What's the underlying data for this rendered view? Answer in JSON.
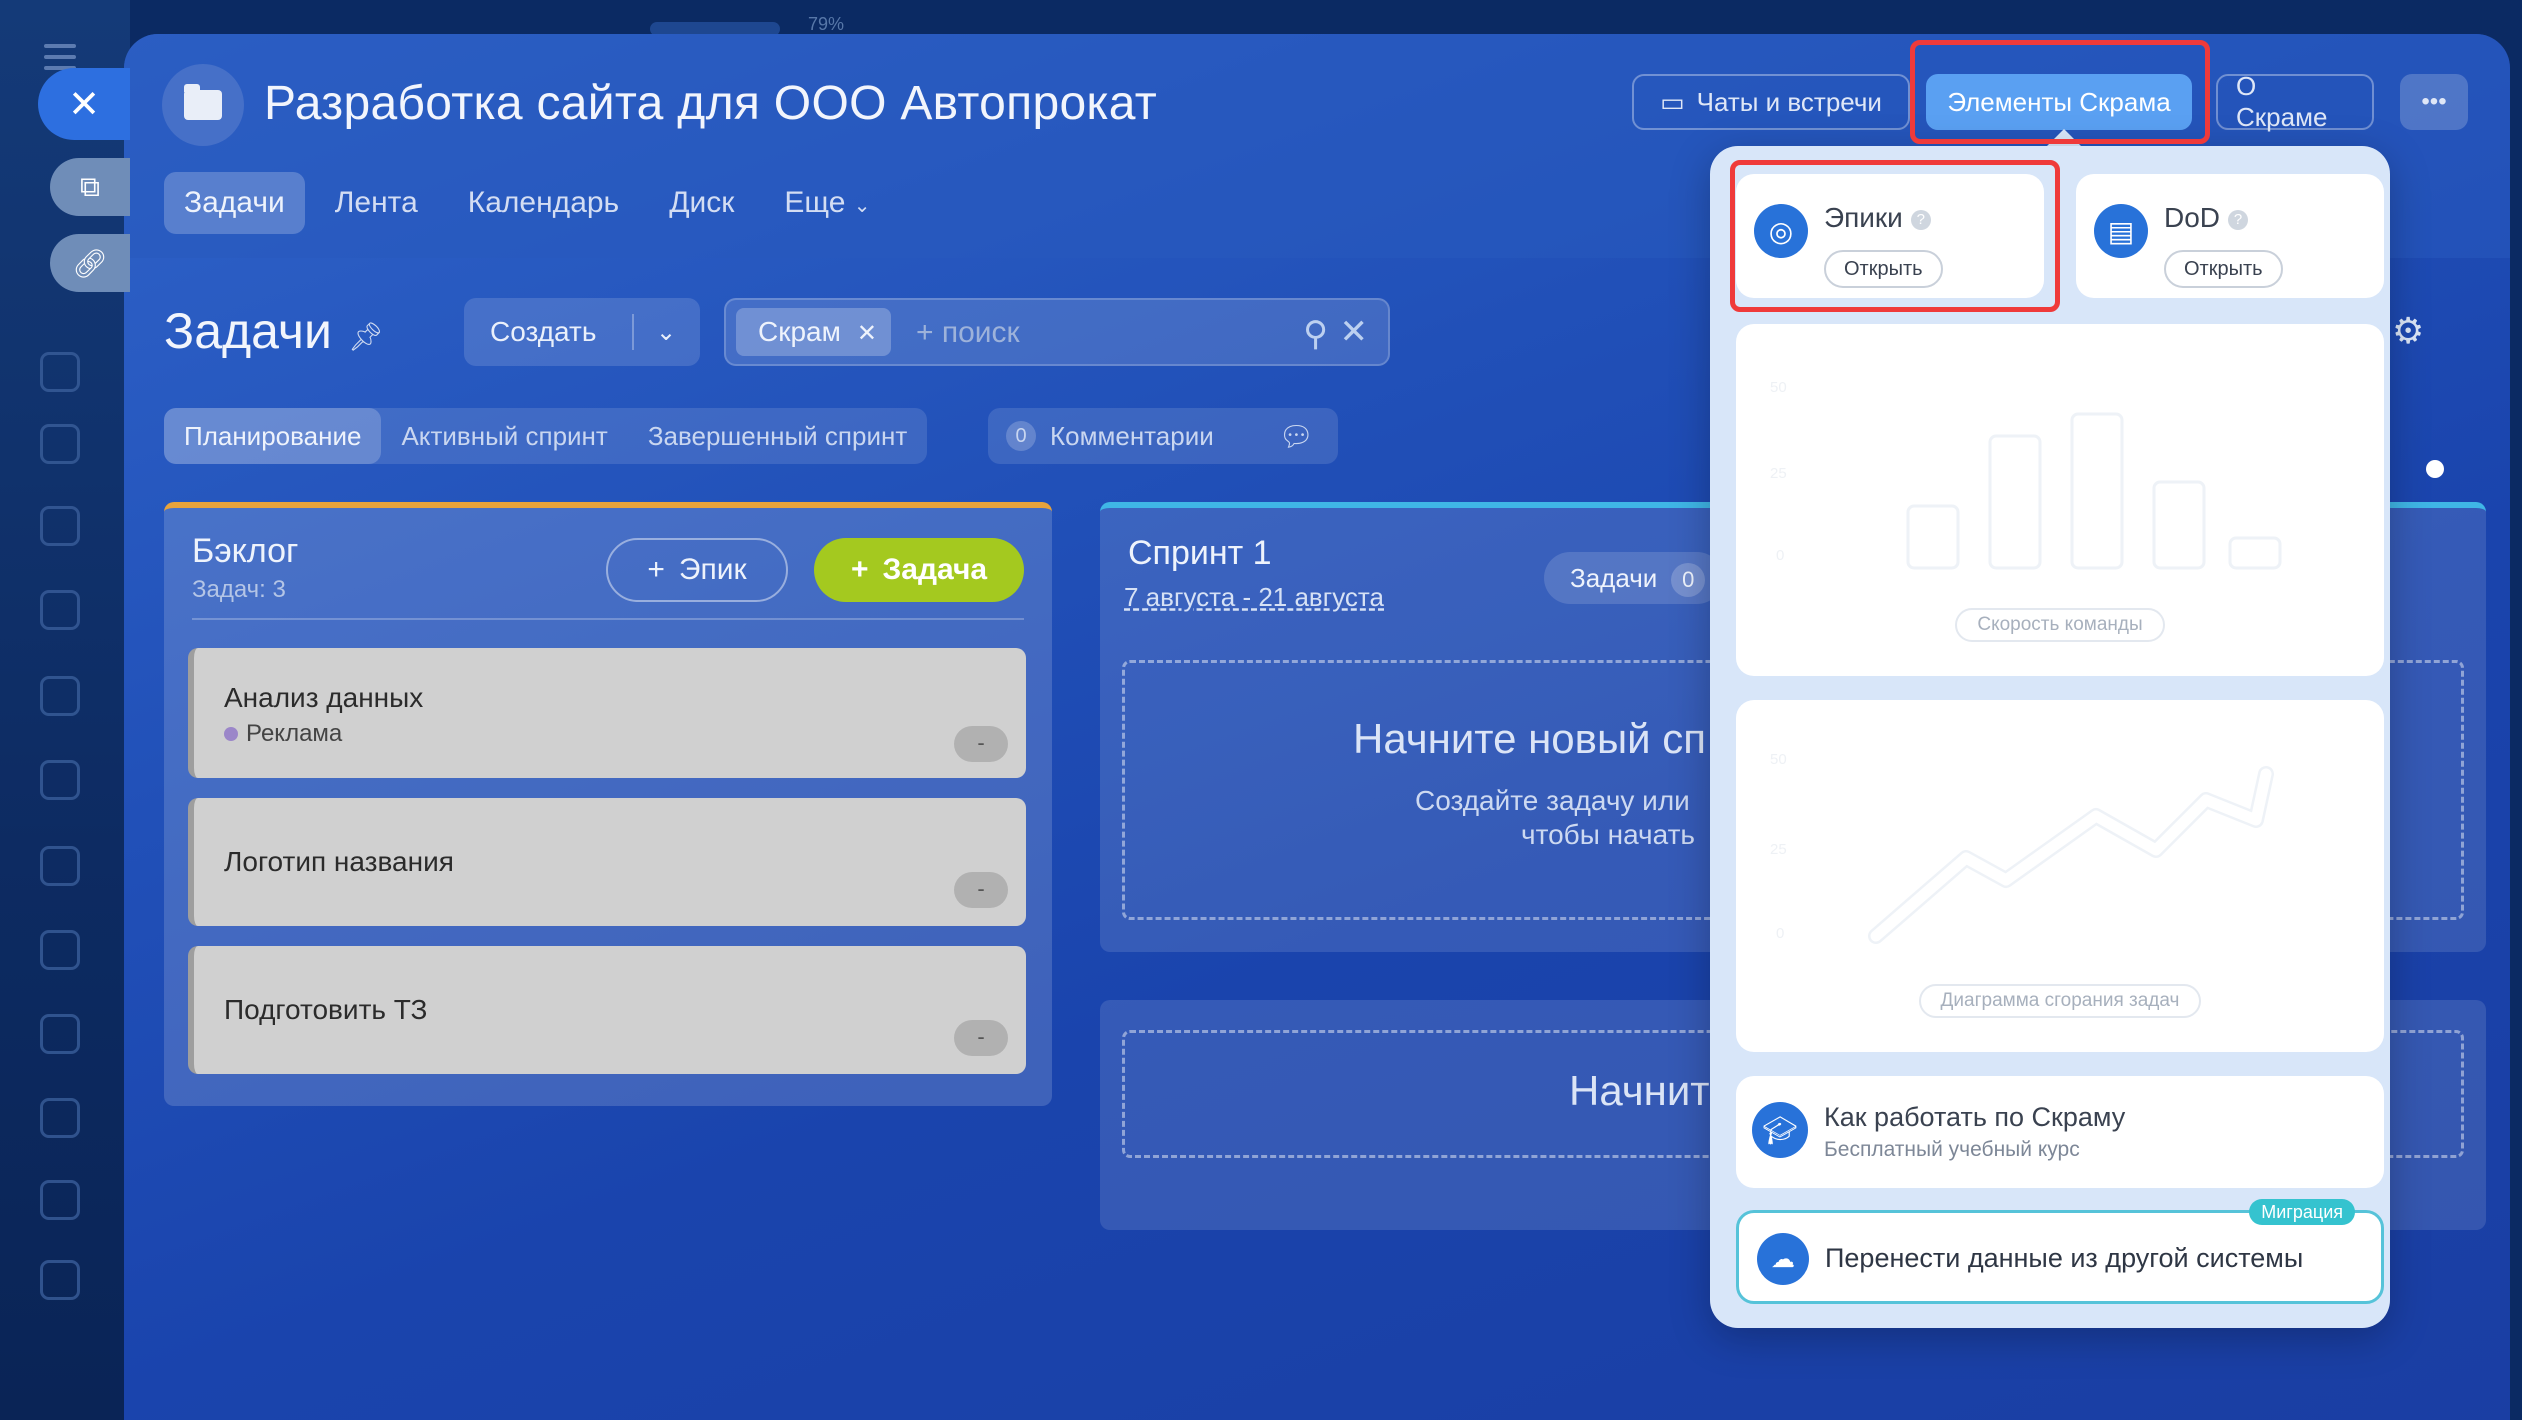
{
  "browser": {
    "zoom": "79%"
  },
  "header": {
    "title": "Разработка сайта для ООО Автопрокат",
    "buttons": {
      "chats": "Чаты и встречи",
      "scrum_elements": "Элементы Скрама",
      "about_scrum": "О Скраме",
      "more": "•••"
    }
  },
  "tabs": [
    "Задачи",
    "Лента",
    "Календарь",
    "Диск",
    "Еще"
  ],
  "section": {
    "title": "Задачи"
  },
  "toolbar": {
    "create_label": "Создать",
    "filter_chip": "Скрам",
    "search_placeholder": "+ поиск"
  },
  "subtabs": [
    "Планирование",
    "Активный спринт",
    "Завершенный спринт"
  ],
  "comments": {
    "count": "0",
    "label": "Комментарии"
  },
  "backlog": {
    "title": "Бэклог",
    "count_label": "Задач: 3",
    "epic_button": "Эпик",
    "task_button": "Задача",
    "items": [
      {
        "title": "Анализ данных",
        "tag": "Реклама",
        "badge": "-"
      },
      {
        "title": "Логотип названия",
        "badge": "-"
      },
      {
        "title": "Подготовить ТЗ",
        "badge": "-"
      }
    ]
  },
  "sprint": {
    "title": "Спринт 1",
    "dates": "7 августа - 21 августа",
    "tasks_label": "Задачи",
    "tasks_count": "0",
    "empty_title": "Начните новый сп",
    "empty_sub_1": "Создайте задачу или",
    "empty_sub_2": "чтобы начать",
    "empty_title_2": "Начните"
  },
  "popup": {
    "epics": {
      "name": "Эпики",
      "open": "Открыть"
    },
    "dod": {
      "name": "DoD",
      "open": "Открыть"
    },
    "velocity_label": "Скорость команды",
    "burndown_label": "Диаграмма сгорания задач",
    "course": {
      "title": "Как работать по Скраму",
      "subtitle": "Бесплатный учебный курс"
    },
    "migrate": {
      "title": "Перенести данные из другой системы",
      "tag": "Миграция"
    },
    "chart_ticks": [
      "50",
      "25",
      "0"
    ]
  },
  "colors": {
    "accent": "#5aa0f2",
    "highlight": "#ef3a3a",
    "task_button": "#a4c91f",
    "backlog_border": "#e8a33b"
  }
}
